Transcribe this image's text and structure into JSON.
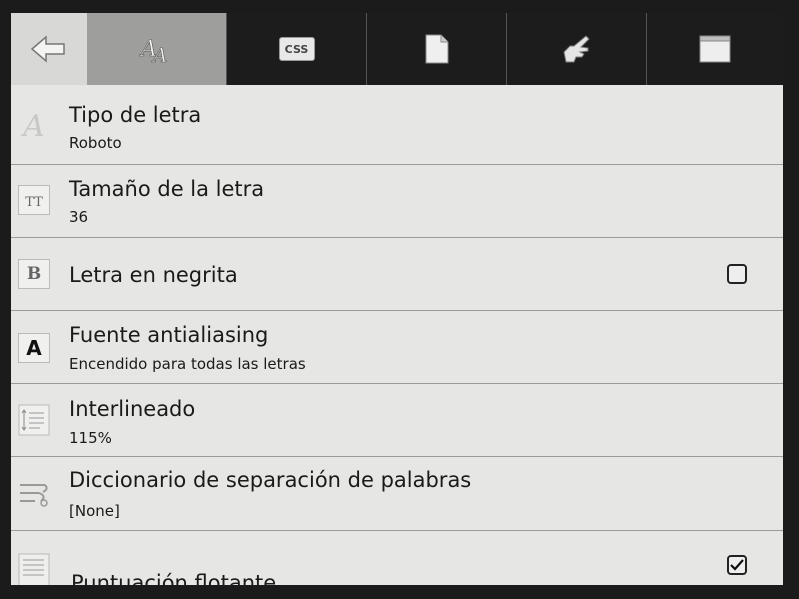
{
  "toolbar": {
    "css_label": "CSS"
  },
  "settings": [
    {
      "title": "Tipo de letra",
      "value": "Roboto"
    },
    {
      "title": "Tamaño de la letra",
      "value": "36"
    },
    {
      "title": "Letra en negrita",
      "checked": false
    },
    {
      "title": "Fuente antialiasing",
      "value": "Encendido para todas las letras"
    },
    {
      "title": "Interlineado",
      "value": "115%"
    },
    {
      "title": "Diccionario de separación de palabras",
      "value": "[None]"
    },
    {
      "title": "Puntuación flotante",
      "checked": true
    }
  ],
  "icons": {
    "font_type": "A",
    "font_size": "TT",
    "bold": "B",
    "antialias": "A"
  }
}
